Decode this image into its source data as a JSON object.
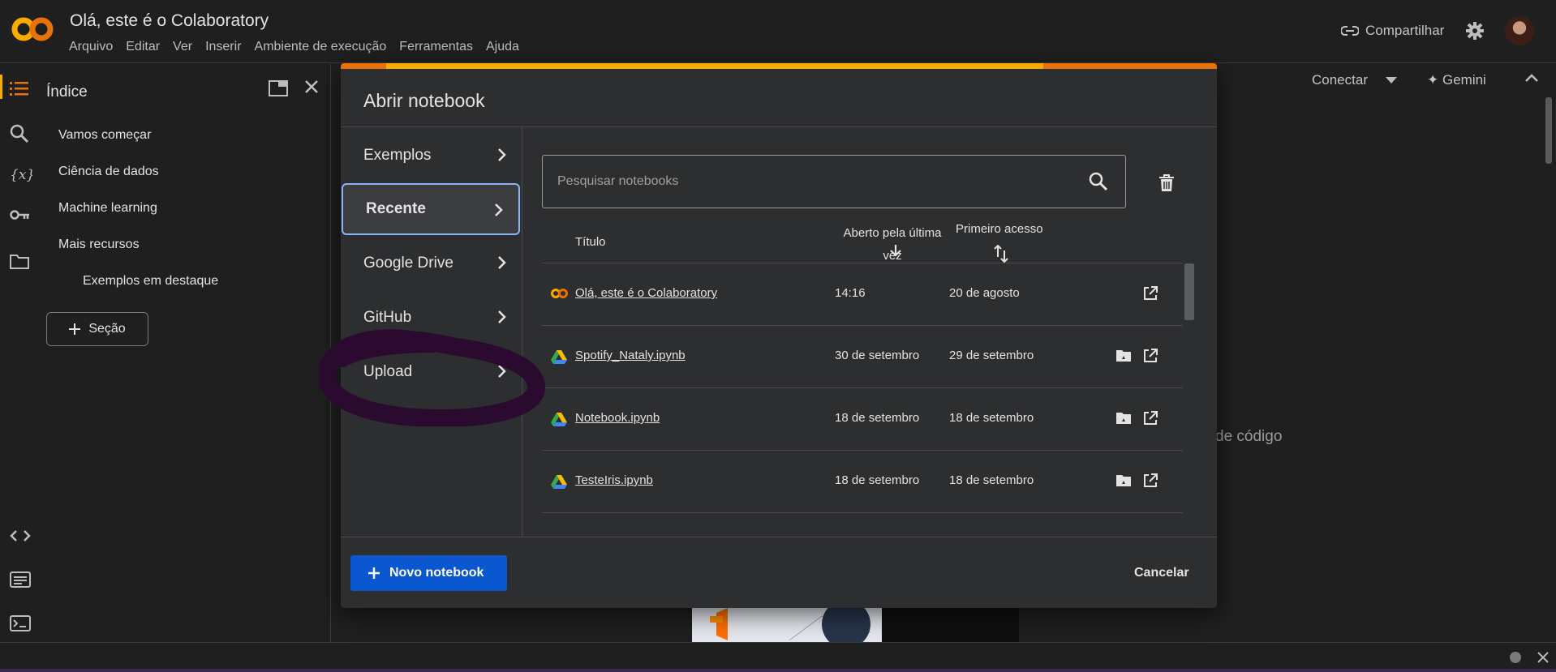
{
  "app": {
    "notebook_title": "Olá, este é o Colaboratory",
    "menu": [
      "Arquivo",
      "Editar",
      "Ver",
      "Inserir",
      "Ambiente de execução",
      "Ferramentas",
      "Ajuda"
    ],
    "share_label": "Compartilhar"
  },
  "sidebar": {
    "title": "Índice",
    "toc": [
      {
        "label": "Vamos começar",
        "level": 1
      },
      {
        "label": "Ciência de dados",
        "level": 1
      },
      {
        "label": "Machine learning",
        "level": 1
      },
      {
        "label": "Mais recursos",
        "level": 1
      },
      {
        "label": "Exemplos em destaque",
        "level": 2
      }
    ],
    "section_button": "Seção"
  },
  "toolbar": {
    "connect_label": "Conectar",
    "gemini_label": "Gemini"
  },
  "background": {
    "partial_text": "de código"
  },
  "dialog": {
    "title": "Abrir notebook",
    "nav": [
      {
        "label": "Exemplos",
        "active": false
      },
      {
        "label": "Recente",
        "active": true
      },
      {
        "label": "Google Drive",
        "active": false
      },
      {
        "label": "GitHub",
        "active": false
      },
      {
        "label": "Upload",
        "active": false
      }
    ],
    "search_placeholder": "Pesquisar notebooks",
    "columns": {
      "title": "Título",
      "last_opened": "Aberto pela última vez",
      "first_opened": "Primeiro acesso"
    },
    "rows": [
      {
        "icon": "colab-icon",
        "name": "Olá, este é o Colaboratory",
        "last_opened": "14:16",
        "first_opened": "20 de agosto",
        "drive_folder": false
      },
      {
        "icon": "google-drive-icon",
        "name": "Spotify_Nataly.ipynb",
        "last_opened": "30 de setembro",
        "first_opened": "29 de setembro",
        "drive_folder": true
      },
      {
        "icon": "google-drive-icon",
        "name": "Notebook.ipynb",
        "last_opened": "18 de setembro",
        "first_opened": "18 de setembro",
        "drive_folder": true
      },
      {
        "icon": "google-drive-icon",
        "name": "TesteIris.ipynb",
        "last_opened": "18 de setembro",
        "first_opened": "18 de setembro",
        "drive_folder": true
      }
    ],
    "new_notebook_label": "Novo notebook",
    "cancel_label": "Cancelar"
  },
  "colors": {
    "accent_orange": "#e8710a",
    "accent_yellow": "#f9ab00",
    "primary_blue": "#0b57d0",
    "annotation_purple": "#2a0a2e"
  }
}
